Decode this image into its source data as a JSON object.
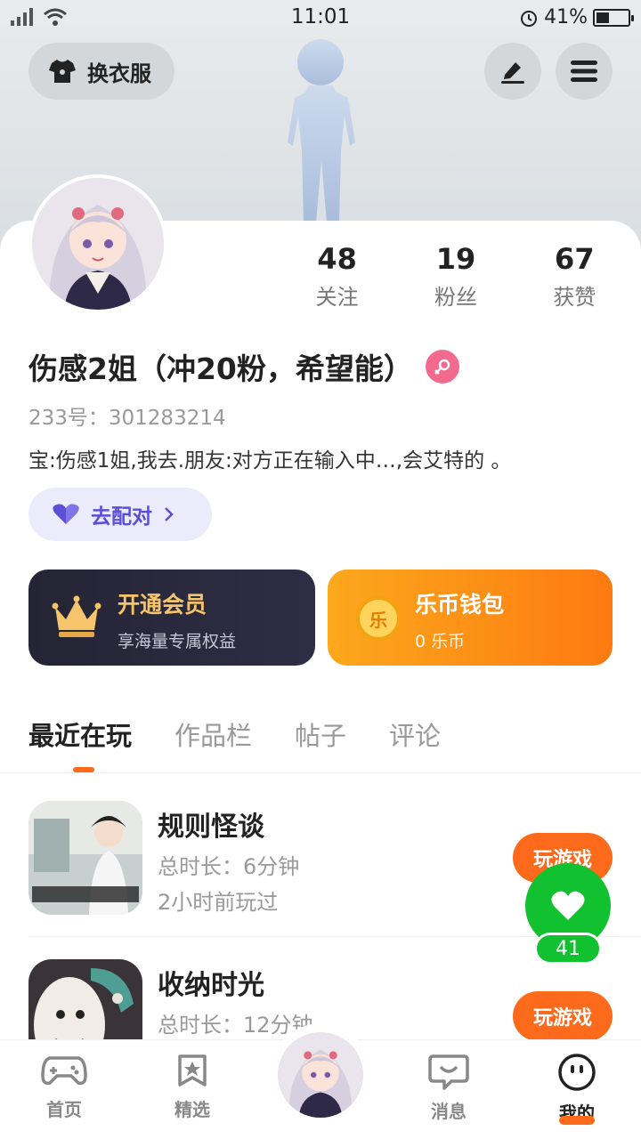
{
  "status_bar": {
    "time": "11:01",
    "battery": "41%",
    "battery_level": 0.41
  },
  "header": {
    "outfit_label": "换衣服"
  },
  "profile": {
    "stats": [
      {
        "value": "48",
        "label": "关注"
      },
      {
        "value": "19",
        "label": "粉丝"
      },
      {
        "value": "67",
        "label": "获赞"
      }
    ],
    "nickname": "伤感2姐（冲20粉，希望能）",
    "uid": "233号：301283214",
    "bio": "宝:伤感1姐,我去.朋友:对方正在输入中…,会艾特的 。",
    "match_label": "去配对"
  },
  "vip": {
    "title": "开通会员",
    "subtitle": "享海量专属权益"
  },
  "wallet": {
    "title": "乐币钱包",
    "subtitle": "0 乐币",
    "coin_glyph": "乐"
  },
  "tabs": [
    "最近在玩",
    "作品栏",
    "帖子",
    "评论"
  ],
  "games": [
    {
      "title": "规则怪谈",
      "duration": "总时长：6分钟",
      "last_played": "2小时前玩过",
      "play_label": "玩游戏"
    },
    {
      "title": "收纳时光",
      "duration": "总时长：12分钟",
      "play_label": "玩游戏"
    }
  ],
  "like": {
    "count": "41"
  },
  "bottom_nav": [
    {
      "label": "首页",
      "icon": "gamepad-icon"
    },
    {
      "label": "精选",
      "icon": "star-bookmark-icon"
    },
    {
      "label": "消息",
      "icon": "chat-bubble-icon"
    },
    {
      "label": "我的",
      "icon": "smiley-face-icon"
    }
  ],
  "colors": {
    "accent": "#fd6a1b",
    "match": "#5b4fd8",
    "like": "#12c12f",
    "gender": "#f26a8d"
  }
}
